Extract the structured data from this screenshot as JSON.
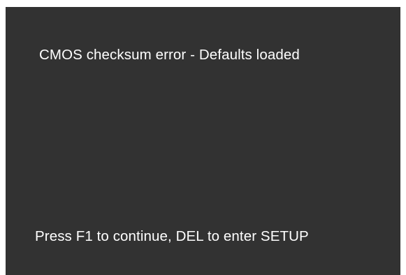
{
  "screen": {
    "background_color": "#323232",
    "text_color": "#ffffff",
    "error_message": "CMOS checksum error - Defaults loaded",
    "prompt_message": "Press F1 to continue, DEL to enter SETUP"
  }
}
